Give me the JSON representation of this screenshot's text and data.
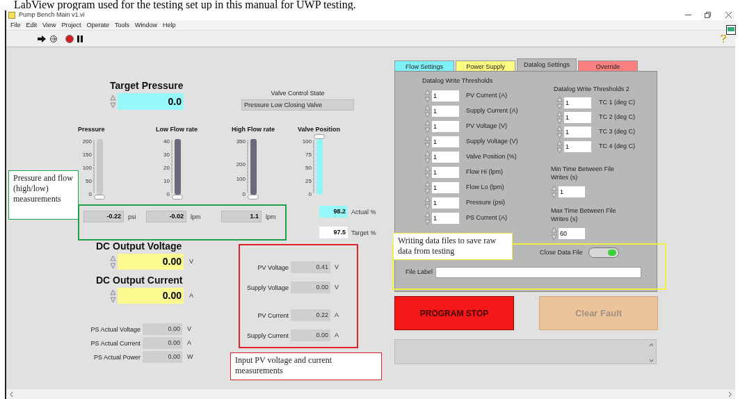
{
  "caption": "LabView program used for the testing set up in this manual for UWP testing.",
  "window": {
    "title": "Pump Bench Main v1.vi",
    "menu": [
      "File",
      "Edit",
      "View",
      "Project",
      "Operate",
      "Tools",
      "Window",
      "Help"
    ]
  },
  "front_panel": {
    "target_pressure": {
      "label": "Target Pressure",
      "value": "0.0"
    },
    "valve_control_state": {
      "label": "Valve Control State",
      "value": "Pressure Low Closing Valve"
    },
    "slides": [
      {
        "label": "Pressure",
        "kind": "pressure",
        "ticks": [
          "200",
          "150",
          "100",
          "50",
          "0"
        ],
        "level": 0
      },
      {
        "label": "Low Flow rate",
        "kind": "flow",
        "ticks": [
          "40",
          "30",
          "20",
          "10",
          "0"
        ],
        "level": 0
      },
      {
        "label": "High Flow rate",
        "kind": "flow",
        "ticks": [
          "350",
          "200",
          "100",
          "0"
        ],
        "level": 0
      },
      {
        "label": "Valve Position",
        "kind": "valve",
        "ticks": [
          "100",
          "75",
          "50",
          "25",
          "0"
        ],
        "level": 1
      }
    ],
    "readings": [
      {
        "value": "-0.22",
        "unit": "psi"
      },
      {
        "value": "-0.02",
        "unit": "lpm"
      },
      {
        "value": "1.1",
        "unit": "lpm"
      }
    ],
    "valve_actual": {
      "value": "98.2",
      "label": "Actual %"
    },
    "valve_target": {
      "value": "97.5",
      "label": "Target %"
    },
    "dc_output_voltage": {
      "label": "DC Output Voltage",
      "value": "0.00",
      "unit": "V"
    },
    "dc_output_current": {
      "label": "DC Output Current",
      "value": "0.00",
      "unit": "A"
    },
    "ps_actual": [
      {
        "label": "PS Actual Voltage",
        "value": "0.00",
        "unit": "V"
      },
      {
        "label": "PS Actual Current",
        "value": "0.00",
        "unit": "A"
      },
      {
        "label": "PS Actual Power",
        "value": "0.00",
        "unit": "W"
      }
    ],
    "pv_measurements": [
      {
        "label": "PV Voltage",
        "value": "0.41",
        "unit": "V"
      },
      {
        "label": "Supply Voltage",
        "value": "0.00",
        "unit": "V"
      },
      {
        "label": "PV Current",
        "value": "0.22",
        "unit": "A"
      },
      {
        "label": "Supply Current",
        "value": "0.00",
        "unit": "A"
      }
    ],
    "tabs": [
      {
        "label": "Flow Settings",
        "selected": false,
        "color": "#80f0f8"
      },
      {
        "label": "Power Supply",
        "selected": false,
        "color": "#fcfc80"
      },
      {
        "label": "Datalog Settings",
        "selected": true,
        "color": "#b8b8b8"
      },
      {
        "label": "Override",
        "selected": false,
        "color": "#f88080"
      }
    ],
    "datalog": {
      "thresholds_label": "Datalog Write Thresholds",
      "thresholds": [
        {
          "value": "1",
          "label": "PV Current (A)"
        },
        {
          "value": "1",
          "label": "Supply Current (A)"
        },
        {
          "value": "1",
          "label": "PV Voltage (V)"
        },
        {
          "value": "1",
          "label": "Supply Voltage (V)"
        },
        {
          "value": "1",
          "label": "Valve Position (%)"
        },
        {
          "value": "1",
          "label": "Flow Hi (lpm)"
        },
        {
          "value": "1",
          "label": "Flow Lo (lpm)"
        },
        {
          "value": "1",
          "label": "Pressure (psi)"
        },
        {
          "value": "1",
          "label": "PS Current (A)"
        }
      ],
      "thresholds2_label": "Datalog Write Thresholds 2",
      "thresholds2": [
        {
          "value": "1",
          "label": "TC 1 (deg C)"
        },
        {
          "value": "1",
          "label": "TC 2 (deg C)"
        },
        {
          "value": "1",
          "label": "TC 3 (deg C)"
        },
        {
          "value": "1",
          "label": "TC 4 (deg C)"
        }
      ],
      "min_time": {
        "label": "Min Time Between File Writes (s)",
        "value": "1"
      },
      "max_time": {
        "label": "Max Time Between File Writes (s)",
        "value": "60"
      },
      "close_data_file": {
        "label": "Close Data File",
        "on": true
      },
      "file_label": {
        "label": "File Label"
      }
    },
    "program_stop": {
      "label": "PROGRAM STOP"
    },
    "clear_fault": {
      "label": "Clear Fault",
      "disabled": true
    }
  },
  "annotations": [
    {
      "text": "Pressure and flow (high/low) measurements",
      "color": "#1fa04a"
    },
    {
      "text": "Input PV voltage and current measurements",
      "color": "#e0202a"
    },
    {
      "text": "Writing data files to save raw data from testing",
      "color": "#f0f040"
    }
  ]
}
